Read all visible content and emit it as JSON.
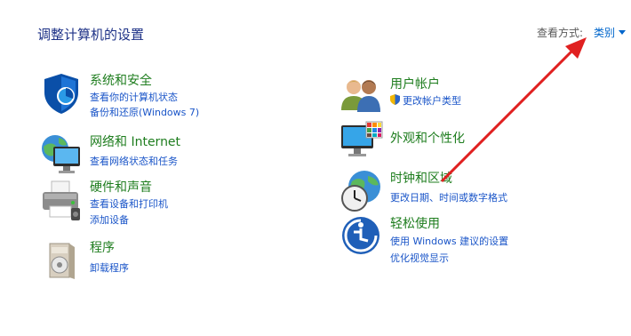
{
  "header": {
    "title": "调整计算机的设置",
    "view_by_label": "查看方式:",
    "view_by_value": "类别"
  },
  "categories": [
    {
      "title": "系统和安全",
      "icon": "shield-icon",
      "links": [
        "查看你的计算机状态",
        "备份和还原(Windows 7)"
      ]
    },
    {
      "title": "网络和 Internet",
      "icon": "network-globe-icon",
      "links": [
        "查看网络状态和任务"
      ]
    },
    {
      "title": "硬件和声音",
      "icon": "printer-icon",
      "links": [
        "查看设备和打印机",
        "添加设备"
      ]
    },
    {
      "title": "程序",
      "icon": "programs-box-icon",
      "links": [
        "卸载程序"
      ]
    },
    {
      "title": "用户帐户",
      "icon": "user-accounts-icon",
      "links": [
        "更改帐户类型"
      ]
    },
    {
      "title": "外观和个性化",
      "icon": "appearance-monitor-icon",
      "links": []
    },
    {
      "title": "时钟和区域",
      "icon": "clock-globe-icon",
      "links": [
        "更改日期、时间或数字格式"
      ]
    },
    {
      "title": "轻松使用",
      "icon": "ease-of-access-icon",
      "links": [
        "使用 Windows 建议的设置",
        "优化视觉显示"
      ]
    }
  ],
  "colors": {
    "title_green": "#1e7d1e",
    "link_blue": "#1a55c8",
    "arrow_red": "#e02020"
  }
}
